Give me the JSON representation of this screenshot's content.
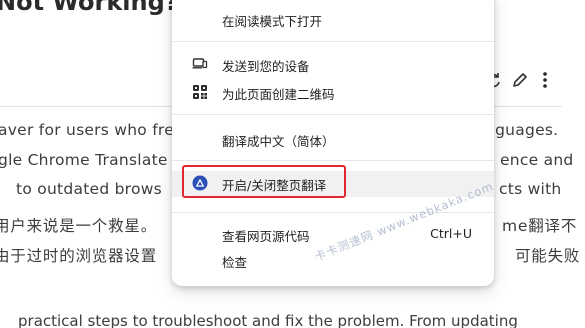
{
  "article": {
    "title": "Not Working?",
    "lines": [
      {
        "left": "aver for users who fre",
        "right": "nguages."
      },
      {
        "left": "gle Chrome Translate",
        "right": "ence and"
      },
      {
        "left": "to outdated brows",
        "right": "cts with"
      },
      {
        "left": "用户来说是一个救星。",
        "right": "me翻译不"
      },
      {
        "left": "由于过时的浏览器设置",
        "right": "可能失败"
      },
      {
        "left": "practical steps to troubleshoot and fix the problem. From updating",
        "right": ""
      }
    ]
  },
  "toolbar": {
    "icons": [
      "refresh-icon",
      "edit-pencil-icon",
      "more-vertical-icon"
    ]
  },
  "context_menu": {
    "items": [
      {
        "label": "在阅读模式下打开",
        "icon": "",
        "shortcut": ""
      },
      {
        "label": "发送到您的设备",
        "icon": "device-send-icon",
        "shortcut": ""
      },
      {
        "label": "为此页面创建二维码",
        "icon": "qr-code-icon",
        "shortcut": ""
      },
      {
        "label": "翻译成中文（简体）",
        "icon": "",
        "shortcut": ""
      },
      {
        "label": "开启/关闭整页翻译",
        "icon": "translate-extension-icon",
        "shortcut": ""
      },
      {
        "label": "查看网页源代码",
        "icon": "",
        "shortcut": "Ctrl+U"
      },
      {
        "label": "检查",
        "icon": "",
        "shortcut": ""
      }
    ]
  },
  "watermark": "卡卡测速网 www.webkaka.com",
  "colors": {
    "highlight_border": "#e0282e",
    "translate_icon": "#2a4fb8"
  }
}
